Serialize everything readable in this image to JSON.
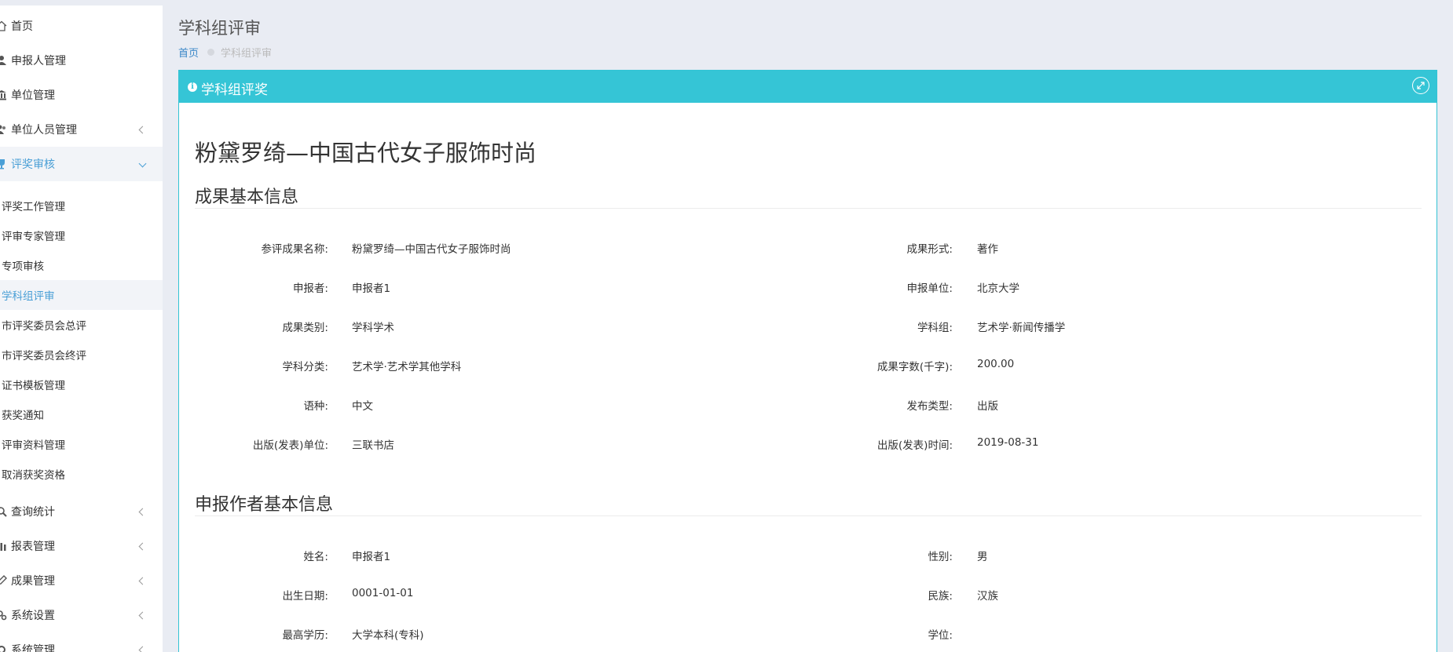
{
  "sidebar": {
    "menu": [
      {
        "label": "首页",
        "icon": "home-icon",
        "has_arrow": false,
        "open": false
      },
      {
        "label": "申报人管理",
        "icon": "user-icon",
        "has_arrow": false,
        "open": false
      },
      {
        "label": "单位管理",
        "icon": "building-icon",
        "has_arrow": false,
        "open": false
      },
      {
        "label": "单位人员管理",
        "icon": "users-icon",
        "has_arrow": true,
        "open": false
      },
      {
        "label": "评奖审核",
        "icon": "trophy-icon",
        "has_arrow": true,
        "open": true
      }
    ],
    "submenu": [
      {
        "label": "评奖工作管理"
      },
      {
        "label": "评审专家管理"
      },
      {
        "label": "专项审核"
      },
      {
        "label": "学科组评审",
        "active": true
      },
      {
        "label": "市评奖委员会总评"
      },
      {
        "label": "市评奖委员会终评"
      },
      {
        "label": "证书模板管理"
      },
      {
        "label": "获奖通知"
      },
      {
        "label": "评审资料管理"
      },
      {
        "label": "取消获奖资格"
      }
    ],
    "menu_after": [
      {
        "label": "查询统计",
        "icon": "search-icon",
        "has_arrow": true
      },
      {
        "label": "报表管理",
        "icon": "bar-chart-icon",
        "has_arrow": true
      },
      {
        "label": "成果管理",
        "icon": "pencil-icon",
        "has_arrow": true
      },
      {
        "label": "系统设置",
        "icon": "gears-icon",
        "has_arrow": true
      },
      {
        "label": "系统管理",
        "icon": "gear-icon",
        "has_arrow": true
      }
    ]
  },
  "header": {
    "title": "学科组评审",
    "breadcrumb_home": "首页",
    "breadcrumb_current": "学科组评审"
  },
  "panel": {
    "title": "学科组评奖",
    "doc_title": "粉黛罗绮—中国古代女子服饰时尚",
    "section1_title": "成果基本信息",
    "section1_fields": [
      {
        "label": "参评成果名称:",
        "value": "粉黛罗绮—中国古代女子服饰时尚"
      },
      {
        "label": "成果形式:",
        "value": "著作"
      },
      {
        "label": "申报者:",
        "value": "申报者1"
      },
      {
        "label": "申报单位:",
        "value": "北京大学"
      },
      {
        "label": "成果类别:",
        "value": "学科学术"
      },
      {
        "label": "学科组:",
        "value": "艺术学·新闻传播学"
      },
      {
        "label": "学科分类:",
        "value": "艺术学·艺术学其他学科"
      },
      {
        "label": "成果字数(千字):",
        "value": "200.00"
      },
      {
        "label": "语种:",
        "value": "中文"
      },
      {
        "label": "发布类型:",
        "value": "出版"
      },
      {
        "label": "出版(发表)单位:",
        "value": "三联书店"
      },
      {
        "label": "出版(发表)时间:",
        "value": "2019-08-31"
      }
    ],
    "section2_title": "申报作者基本信息",
    "section2_fields": [
      {
        "label": "姓名:",
        "value": "申报者1"
      },
      {
        "label": "性别:",
        "value": "男"
      },
      {
        "label": "出生日期:",
        "value": "0001-01-01"
      },
      {
        "label": "民族:",
        "value": "汉族"
      },
      {
        "label": "最高学历:",
        "value": "大学本科(专科)"
      },
      {
        "label": "学位:",
        "value": ""
      }
    ]
  },
  "colors": {
    "accent": "#35c5d6",
    "link": "#3a87c8",
    "active_menu": "#4a9fd6",
    "background": "#e9ecf3"
  }
}
